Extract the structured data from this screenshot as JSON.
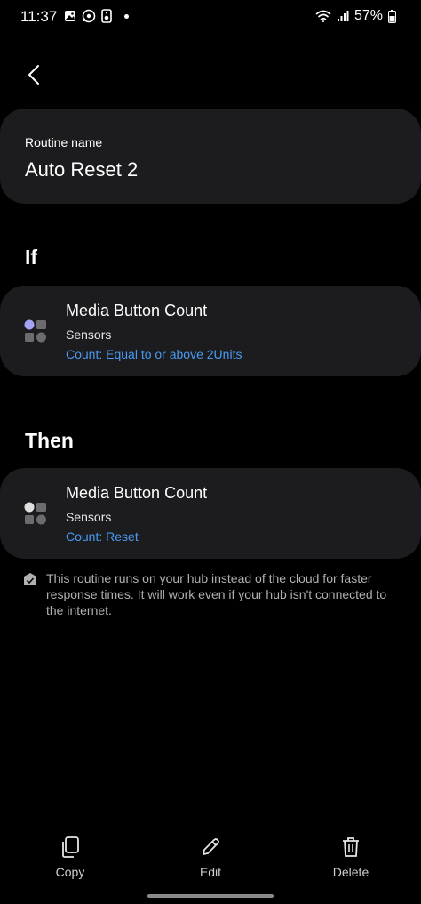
{
  "status_bar": {
    "time": "11:37",
    "battery": "57%",
    "icons_left": [
      "gallery-icon",
      "whatsapp-icon",
      "speaker-icon",
      "dot-icon"
    ],
    "icons_right": [
      "wifi-icon",
      "signal-icon",
      "battery-icon"
    ]
  },
  "routine": {
    "name_label": "Routine name",
    "name_value": "Auto Reset 2"
  },
  "if_section": {
    "title": "If",
    "device": {
      "name": "Media Button Count",
      "category": "Sensors",
      "condition": "Count: Equal to or above 2Units",
      "icon": "sensor-grid-icon",
      "accent_color": "#a6a3f5"
    }
  },
  "then_section": {
    "title": "Then",
    "device": {
      "name": "Media Button Count",
      "category": "Sensors",
      "condition": "Count: Reset",
      "icon": "sensor-grid-icon",
      "accent_color": "#e0e0e0"
    }
  },
  "info": {
    "text": "This routine runs on your hub instead of the cloud for faster response times. It will work even if your hub isn't connected to the internet.",
    "icon": "hub-icon"
  },
  "actions": {
    "copy": "Copy",
    "edit": "Edit",
    "delete": "Delete"
  },
  "colors": {
    "background": "#000000",
    "card": "#1c1c1e",
    "link": "#4a9af3"
  }
}
